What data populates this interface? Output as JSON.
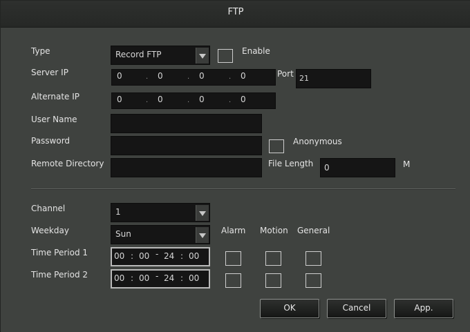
{
  "dialog": {
    "title": "FTP"
  },
  "form": {
    "type": {
      "label": "Type",
      "value": "Record FTP"
    },
    "enable": {
      "label": "Enable",
      "checked": false
    },
    "server_ip": {
      "label": "Server IP",
      "octets": [
        "0",
        "0",
        "0",
        "0"
      ]
    },
    "port": {
      "label": "Port",
      "value": "21"
    },
    "alternate_ip": {
      "label": "Alternate IP",
      "octets": [
        "0",
        "0",
        "0",
        "0"
      ]
    },
    "user_name": {
      "label": "User Name",
      "value": ""
    },
    "password": {
      "label": "Password",
      "value": ""
    },
    "anonymous": {
      "label": "Anonymous",
      "checked": false
    },
    "remote_directory": {
      "label": "Remote Directory",
      "value": ""
    },
    "file_length": {
      "label": "File Length",
      "value": "0",
      "unit": "M"
    },
    "channel": {
      "label": "Channel",
      "value": "1"
    },
    "weekday": {
      "label": "Weekday",
      "value": "Sun"
    },
    "columns": {
      "alarm": "Alarm",
      "motion": "Motion",
      "general": "General"
    },
    "time_periods": [
      {
        "label": "Time Period 1",
        "start_h": "00",
        "start_m": "00",
        "end_h": "24",
        "end_m": "00",
        "separator": ":",
        "dash": "-",
        "alarm": false,
        "motion": false,
        "general": false
      },
      {
        "label": "Time Period 2",
        "start_h": "00",
        "start_m": "00",
        "end_h": "24",
        "end_m": "00",
        "separator": ":",
        "dash": "-",
        "alarm": false,
        "motion": false,
        "general": false
      }
    ]
  },
  "buttons": {
    "ok": "OK",
    "cancel": "Cancel",
    "apply": "App."
  },
  "colors": {
    "panel": "#3f423f",
    "field": "#151515",
    "title_bar": "#2a2c2a",
    "text": "#e4e4e4"
  }
}
